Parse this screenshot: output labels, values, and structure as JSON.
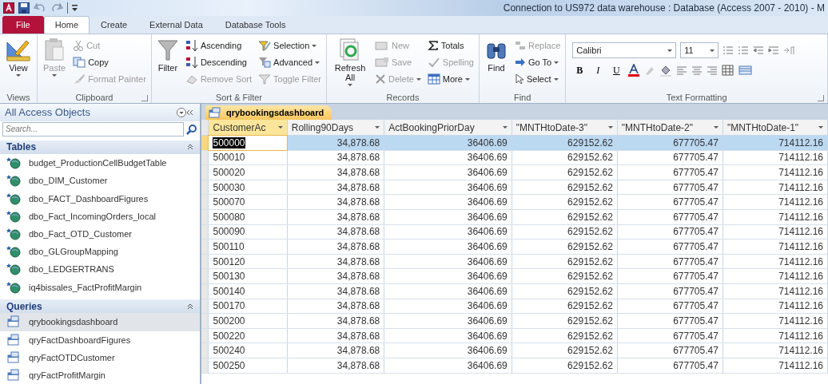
{
  "window": {
    "title": "Connection to US972 data warehouse : Database (Access 2007 - 2010)  -  M"
  },
  "ribbon_tabs": [
    {
      "label": "File",
      "kind": "file",
      "selected": false
    },
    {
      "label": "Home",
      "kind": "tab",
      "selected": true
    },
    {
      "label": "Create",
      "kind": "tab",
      "selected": false
    },
    {
      "label": "External Data",
      "kind": "tab",
      "selected": false
    },
    {
      "label": "Database Tools",
      "kind": "tab",
      "selected": false
    }
  ],
  "ribbon_groups": [
    {
      "label": "Views",
      "launcher": false,
      "commands": [
        {
          "kind": "large",
          "label": "View",
          "disabled": false,
          "caret": true
        }
      ]
    },
    {
      "label": "Clipboard",
      "launcher": true,
      "commands": [
        {
          "kind": "large",
          "label": "Paste",
          "disabled": true,
          "caret": true
        },
        {
          "kind": "small",
          "label": "Cut",
          "disabled": true,
          "caret": false
        },
        {
          "kind": "small",
          "label": "Copy",
          "disabled": false,
          "caret": false
        },
        {
          "kind": "small",
          "label": "Format Painter",
          "disabled": true,
          "caret": false
        }
      ]
    },
    {
      "label": "Sort & Filter",
      "launcher": false,
      "commands": [
        {
          "kind": "large",
          "label": "Filter",
          "disabled": false,
          "caret": false
        },
        {
          "kind": "small",
          "label": "Ascending",
          "disabled": false,
          "caret": false
        },
        {
          "kind": "small",
          "label": "Descending",
          "disabled": false,
          "caret": false
        },
        {
          "kind": "small",
          "label": "Remove Sort",
          "disabled": true,
          "caret": false
        },
        {
          "kind": "small",
          "label": "Selection",
          "disabled": false,
          "caret": true
        },
        {
          "kind": "small",
          "label": "Advanced",
          "disabled": false,
          "caret": true
        },
        {
          "kind": "small",
          "label": "Toggle Filter",
          "disabled": true,
          "caret": false
        }
      ]
    },
    {
      "label": "Records",
      "launcher": false,
      "commands": [
        {
          "kind": "large",
          "label": "Refresh All",
          "disabled": false,
          "caret": true
        },
        {
          "kind": "small",
          "label": "New",
          "disabled": true,
          "caret": false
        },
        {
          "kind": "small",
          "label": "Save",
          "disabled": true,
          "caret": false
        },
        {
          "kind": "small",
          "label": "Delete",
          "disabled": true,
          "caret": true
        },
        {
          "kind": "small",
          "label": "Totals",
          "disabled": false,
          "caret": false
        },
        {
          "kind": "small",
          "label": "Spelling",
          "disabled": true,
          "caret": false
        },
        {
          "kind": "small",
          "label": "More",
          "disabled": false,
          "caret": true
        }
      ]
    },
    {
      "label": "Find",
      "launcher": false,
      "commands": [
        {
          "kind": "large",
          "label": "Find",
          "disabled": false,
          "caret": false
        },
        {
          "kind": "small",
          "label": "Replace",
          "disabled": true,
          "caret": false
        },
        {
          "kind": "small",
          "label": "Go To",
          "disabled": false,
          "caret": true
        },
        {
          "kind": "small",
          "label": "Select",
          "disabled": false,
          "caret": true
        }
      ]
    },
    {
      "label": "Text Formatting",
      "launcher": true,
      "font": "Calibri",
      "size": "11",
      "format_buttons": [
        "B",
        "I",
        "U"
      ]
    }
  ],
  "nav_pane": {
    "title": "All Access Objects",
    "search": {
      "placeholder": "Search..."
    },
    "sections": [
      {
        "label": "Tables",
        "kind": "table",
        "expanded": true,
        "items": [
          {
            "label": "budget_ProductionCellBudgetTable",
            "selected": false
          },
          {
            "label": "dbo_DIM_Customer",
            "selected": false
          },
          {
            "label": "dbo_FACT_DashboardFigures",
            "selected": false
          },
          {
            "label": "dbo_Fact_IncomingOrders_local",
            "selected": false
          },
          {
            "label": "dbo_Fact_OTD_Customer",
            "selected": false
          },
          {
            "label": "dbo_GLGroupMapping",
            "selected": false
          },
          {
            "label": "dbo_LEDGERTRANS",
            "selected": false
          },
          {
            "label": "iq4bissales_FactProfitMargin",
            "selected": false
          }
        ]
      },
      {
        "label": "Queries",
        "kind": "query",
        "expanded": true,
        "items": [
          {
            "label": "qrybookingsdashboard",
            "selected": true
          },
          {
            "label": "qryFactDashboardFigures",
            "selected": false
          },
          {
            "label": "qryFactOTDCustomer",
            "selected": false
          },
          {
            "label": "qryFactProfitMargin",
            "selected": false
          }
        ]
      }
    ]
  },
  "document_tab": {
    "label": "qrybookingsdashboard"
  },
  "table": {
    "columns": [
      {
        "label": "CustomerAc",
        "selected": true
      },
      {
        "label": "Rolling90Days",
        "selected": false
      },
      {
        "label": "ActBookingPriorDay",
        "selected": false
      },
      {
        "label": "\"MNTHtoDate-3\"",
        "selected": false
      },
      {
        "label": "\"MNTHtoDate-2\"",
        "selected": false
      },
      {
        "label": "\"MNTHtoDate-1\"",
        "selected": false
      }
    ],
    "rows": [
      {
        "selected": true,
        "cells": [
          "500000",
          "34,878.68",
          "36406.69",
          "629152.62",
          "677705.47",
          "714112.16"
        ]
      },
      {
        "selected": false,
        "cells": [
          "500010",
          "34,878.68",
          "36406.69",
          "629152.62",
          "677705.47",
          "714112.16"
        ]
      },
      {
        "selected": false,
        "cells": [
          "500020",
          "34,878.68",
          "36406.69",
          "629152.62",
          "677705.47",
          "714112.16"
        ]
      },
      {
        "selected": false,
        "cells": [
          "500030",
          "34,878.68",
          "36406.69",
          "629152.62",
          "677705.47",
          "714112.16"
        ]
      },
      {
        "selected": false,
        "cells": [
          "500070",
          "34,878.68",
          "36406.69",
          "629152.62",
          "677705.47",
          "714112.16"
        ]
      },
      {
        "selected": false,
        "cells": [
          "500080",
          "34,878.68",
          "36406.69",
          "629152.62",
          "677705.47",
          "714112.16"
        ]
      },
      {
        "selected": false,
        "cells": [
          "500090",
          "34,878.68",
          "36406.69",
          "629152.62",
          "677705.47",
          "714112.16"
        ]
      },
      {
        "selected": false,
        "cells": [
          "500110",
          "34,878.68",
          "36406.69",
          "629152.62",
          "677705.47",
          "714112.16"
        ]
      },
      {
        "selected": false,
        "cells": [
          "500120",
          "34,878.68",
          "36406.69",
          "629152.62",
          "677705.47",
          "714112.16"
        ]
      },
      {
        "selected": false,
        "cells": [
          "500130",
          "34,878.68",
          "36406.69",
          "629152.62",
          "677705.47",
          "714112.16"
        ]
      },
      {
        "selected": false,
        "cells": [
          "500140",
          "34,878.68",
          "36406.69",
          "629152.62",
          "677705.47",
          "714112.16"
        ]
      },
      {
        "selected": false,
        "cells": [
          "500170",
          "34,878.68",
          "36406.69",
          "629152.62",
          "677705.47",
          "714112.16"
        ]
      },
      {
        "selected": false,
        "cells": [
          "500200",
          "34,878.68",
          "36406.69",
          "629152.62",
          "677705.47",
          "714112.16"
        ]
      },
      {
        "selected": false,
        "cells": [
          "500220",
          "34,878.68",
          "36406.69",
          "629152.62",
          "677705.47",
          "714112.16"
        ]
      },
      {
        "selected": false,
        "cells": [
          "500240",
          "34,878.68",
          "36406.69",
          "629152.62",
          "677705.47",
          "714112.16"
        ]
      },
      {
        "selected": false,
        "cells": [
          "500250",
          "34,878.68",
          "36406.69",
          "629152.62",
          "677705.47",
          "714112.16"
        ]
      }
    ]
  }
}
